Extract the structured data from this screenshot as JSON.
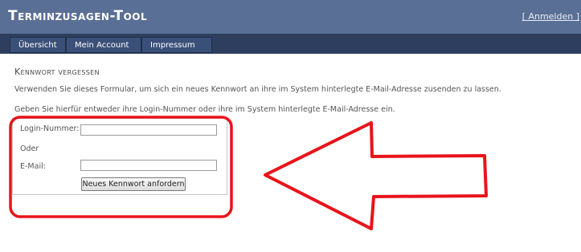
{
  "header": {
    "title": "Terminzusagen-Tool",
    "login_link": "[ Anmelden ]"
  },
  "nav": {
    "items": [
      {
        "label": "Übersicht"
      },
      {
        "label": "Mein Account"
      },
      {
        "label": "Impressum"
      }
    ]
  },
  "main": {
    "title": "Kennwort vergessen",
    "intro": "Verwenden Sie dieses Formular, um sich ein neues Kennwort an ihre im System hinterlegte E-Mail-Adresse zusenden zu lassen.",
    "instruction": "Geben Sie hierfür entweder ihre Login-Nummer oder ihre im System hinterlegte E-Mail-Adresse ein."
  },
  "form": {
    "login_label": "Login-Nummer:",
    "login_value": "",
    "or_label": "Oder",
    "email_label": "E-Mail:",
    "email_value": "",
    "submit_label": "Neues Kennwort anfordern"
  },
  "colors": {
    "header_bg": "#5a6f95",
    "navbar_bg": "#2d3e5e",
    "annotation_red": "#e8141a"
  }
}
